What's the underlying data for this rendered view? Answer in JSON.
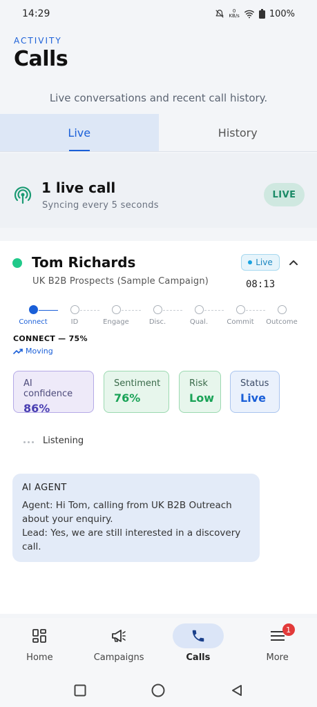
{
  "status_bar": {
    "time": "14:29",
    "net_value": "0",
    "net_unit": "KB/s",
    "battery": "100%"
  },
  "header": {
    "eyebrow": "ACTIVITY",
    "title": "Calls",
    "subtitle": "Live conversations and recent call history."
  },
  "tabs": [
    {
      "label": "Live",
      "active": true
    },
    {
      "label": "History",
      "active": false
    }
  ],
  "live_summary": {
    "count_text": "1 live call",
    "sync_text": "Syncing every 5 seconds",
    "pill": "LIVE"
  },
  "call": {
    "name": "Tom Richards",
    "campaign": "UK B2B Prospects (Sample Campaign)",
    "badge": "Live",
    "timer": "08:13",
    "steps": [
      "Connect",
      "ID",
      "Engage",
      "Disc.",
      "Qual.",
      "Commit",
      "Outcome"
    ],
    "active_step": 0,
    "stage_text": "CONNECT — 75%",
    "stage_progress": 75,
    "trend": "Moving",
    "metrics": [
      {
        "label": "AI confidence",
        "value": "86%"
      },
      {
        "label": "Sentiment",
        "value": "76%"
      },
      {
        "label": "Risk",
        "value": "Low"
      },
      {
        "label": "Status",
        "value": "Live"
      }
    ],
    "listening": "Listening",
    "agent": {
      "title": "AI AGENT",
      "lines": [
        "Agent: Hi Tom, calling from UK B2B Outreach",
        "about your enquiry.",
        "Lead: Yes, we are still interested in a discovery",
        "call."
      ]
    }
  },
  "bottom_nav": [
    {
      "label": "Home",
      "icon": "grid-icon"
    },
    {
      "label": "Campaigns",
      "icon": "megaphone-icon"
    },
    {
      "label": "Calls",
      "icon": "phone-icon",
      "active": true
    },
    {
      "label": "More",
      "icon": "menu-icon",
      "badge": "1"
    }
  ],
  "colors": {
    "accent": "#1a5fd8",
    "live_green": "#21c98a",
    "badge_red": "#e23a3a"
  }
}
